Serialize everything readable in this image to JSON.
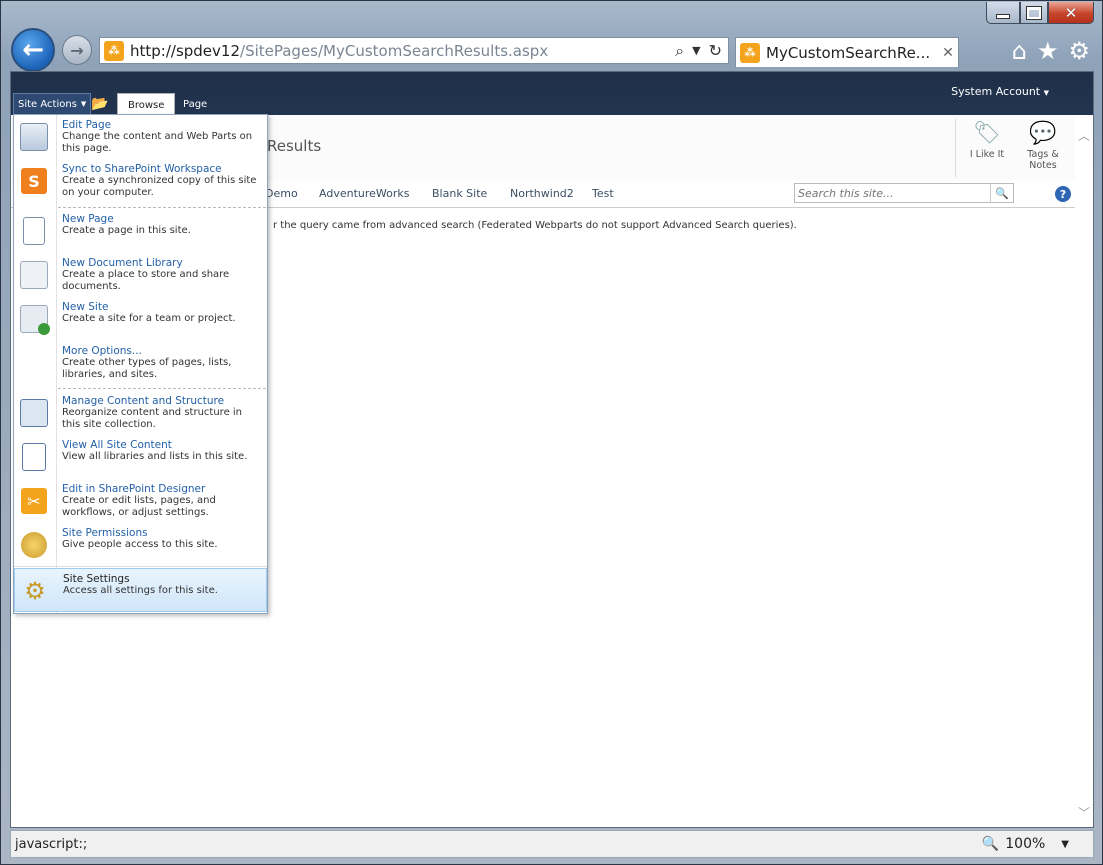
{
  "browser": {
    "url_host": "http://spdev12",
    "url_path": "/SitePages/MyCustomSearchResults.aspx",
    "tab_title": "MyCustomSearchRe...",
    "status_text": "javascript:;",
    "zoom": "100%"
  },
  "ribbon": {
    "site_actions": "Site Actions",
    "tabs": [
      "Browse",
      "Page"
    ],
    "system_account": "System Account"
  },
  "page": {
    "title_partial": "Results",
    "social": [
      {
        "label": "I Like It"
      },
      {
        "label": "Tags & Notes"
      }
    ],
    "nav": [
      "Demo",
      "AdventureWorks",
      "Blank Site",
      "Northwind2",
      "Test"
    ],
    "search_placeholder": "Search this site...",
    "message": "r the query came from advanced search (Federated Webparts do not support Advanced Search queries)."
  },
  "menu": {
    "items": [
      {
        "title": "Edit Page",
        "desc": "Change the content and Web Parts on this page.",
        "icon": "edit-page-icon"
      },
      {
        "title": "Sync to SharePoint Workspace",
        "desc": "Create a synchronized copy of this site on your computer.",
        "icon": "sharepoint-workspace-icon"
      },
      {
        "title": "New Page",
        "desc": "Create a page in this site.",
        "icon": "new-page-icon"
      },
      {
        "title": "New Document Library",
        "desc": "Create a place to store and share documents.",
        "icon": "document-library-icon"
      },
      {
        "title": "New Site",
        "desc": "Create a site for a team or project.",
        "icon": "new-site-icon"
      },
      {
        "title": "More Options...",
        "desc": "Create other types of pages, lists, libraries, and sites.",
        "icon": "more-options-icon"
      },
      {
        "title": "Manage Content and Structure",
        "desc": "Reorganize content and structure in this site collection.",
        "icon": "manage-content-icon"
      },
      {
        "title": "View All Site Content",
        "desc": "View all libraries and lists in this site.",
        "icon": "site-content-icon"
      },
      {
        "title": "Edit in SharePoint Designer",
        "desc": "Create or edit lists, pages, and workflows, or adjust settings.",
        "icon": "sharepoint-designer-icon"
      },
      {
        "title": "Site Permissions",
        "desc": "Give people access to this site.",
        "icon": "permissions-icon"
      },
      {
        "title": "Site Settings",
        "desc": "Access all settings for this site.",
        "icon": "settings-gear-icon"
      }
    ]
  },
  "colors": {
    "accent": "#2361a8",
    "ribbon": "#1f2f48",
    "selected": "#cfe6f9"
  }
}
